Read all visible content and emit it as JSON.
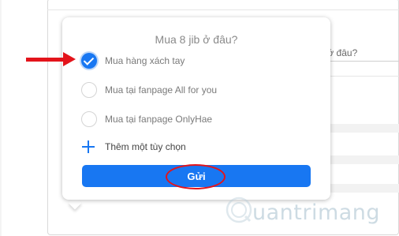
{
  "background": {
    "question_fragment": "jib ở đâu?"
  },
  "poll": {
    "title": "Mua 8 jib ở đâu?",
    "options": [
      {
        "label": "Mua hàng xách tay",
        "checked": true
      },
      {
        "label": "Mua tại fanpage All for you",
        "checked": false
      },
      {
        "label": "Mua tại fanpage OnlyHae",
        "checked": false
      }
    ],
    "add_option_label": "Thêm một tùy chọn",
    "submit_label": "Gửi"
  },
  "colors": {
    "accent": "#1877f2",
    "annotation": "#e3141b"
  },
  "watermark": {
    "text": "uantrimang"
  }
}
